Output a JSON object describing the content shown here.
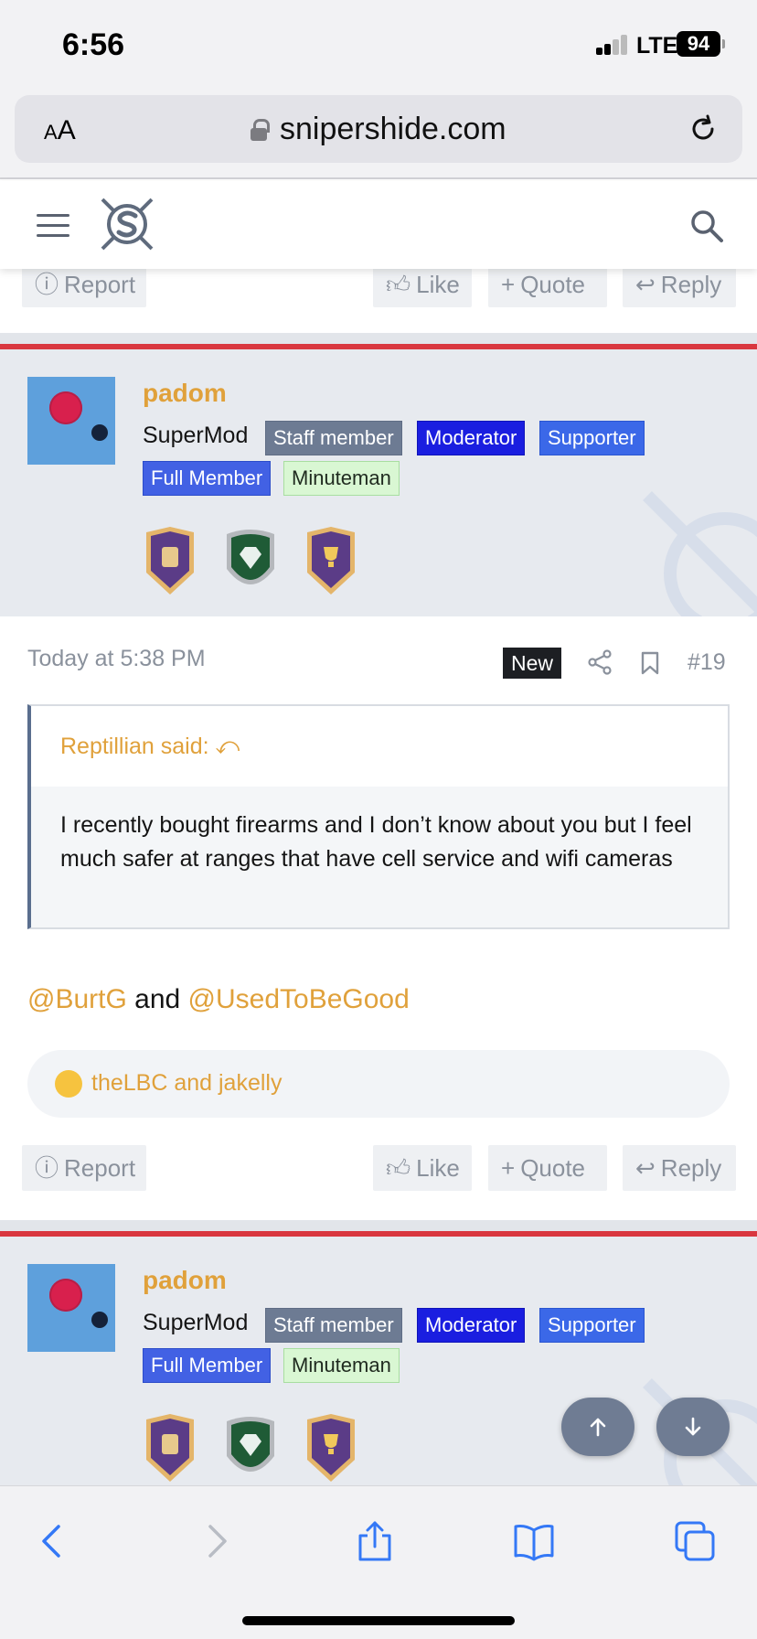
{
  "status": {
    "time": "6:56",
    "network": "LTE",
    "battery": "94"
  },
  "browser": {
    "text_size_label_small": "A",
    "text_size_label_large": "A",
    "url": "snipershide.com"
  },
  "post_prev_actions": {
    "report": "Report",
    "like": "Like",
    "quote": "Quote",
    "reply": "Reply"
  },
  "author": {
    "name": "padom",
    "title": "SuperMod",
    "banners": [
      "Staff member",
      "Moderator",
      "Supporter",
      "Full Member",
      "Minuteman"
    ]
  },
  "post": {
    "timestamp": "Today at 5:38 PM",
    "new_label": "New",
    "number": "#19",
    "quote": {
      "author": "Reptillian said:",
      "text": "I recently bought firearms and I don’t know about you but I feel much safer at ranges that have cell service and wifi cameras"
    },
    "body": {
      "mention1": "@BurtG",
      "and_text": " and ",
      "mention2": "@UsedToBeGood"
    },
    "reactions": "theLBC and jakelly",
    "actions": {
      "report": "Report",
      "like": "Like",
      "quote": "Quote",
      "reply": "Reply"
    }
  },
  "next_author": {
    "name": "padom",
    "title": "SuperMod",
    "banners": [
      "Staff member",
      "Moderator",
      "Supporter",
      "Full Member",
      "Minuteman"
    ]
  },
  "colors": {
    "accent": "#e0a13b",
    "red_rule": "#d9373f",
    "ios_blue": "#3478f6"
  }
}
